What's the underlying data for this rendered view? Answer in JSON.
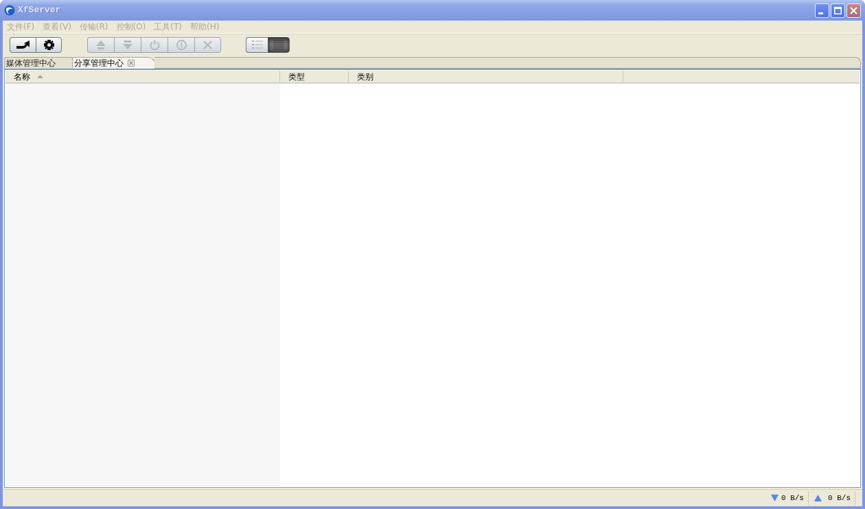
{
  "window": {
    "title": "XfServer",
    "active": false
  },
  "menu": [
    "文件(F)",
    "查看(V)",
    "传输(R)",
    "控制(O)",
    "工具(T)",
    "帮助(H)"
  ],
  "toolbar": {
    "actions": [
      {
        "disabled": false
      },
      {
        "disabled": false
      }
    ],
    "transfer": [
      {
        "disabled": true
      },
      {
        "disabled": true
      },
      {
        "disabled": true
      },
      {
        "disabled": true
      },
      {
        "disabled": true
      }
    ],
    "view": [
      {
        "selected": false
      },
      {
        "selected": true
      }
    ]
  },
  "tabs": [
    {
      "label": "媒体管理中心",
      "selected": false,
      "closable": false
    },
    {
      "label": "分享管理中心",
      "selected": true,
      "closable": true
    }
  ],
  "table": {
    "columns": [
      {
        "label": "名称",
        "sorted": true
      },
      {
        "label": "类型",
        "sorted": false
      },
      {
        "label": "类别",
        "sorted": false
      }
    ]
  },
  "status_bar": {
    "download_rate": "0 B/s",
    "upload_rate": "0 B/s"
  }
}
